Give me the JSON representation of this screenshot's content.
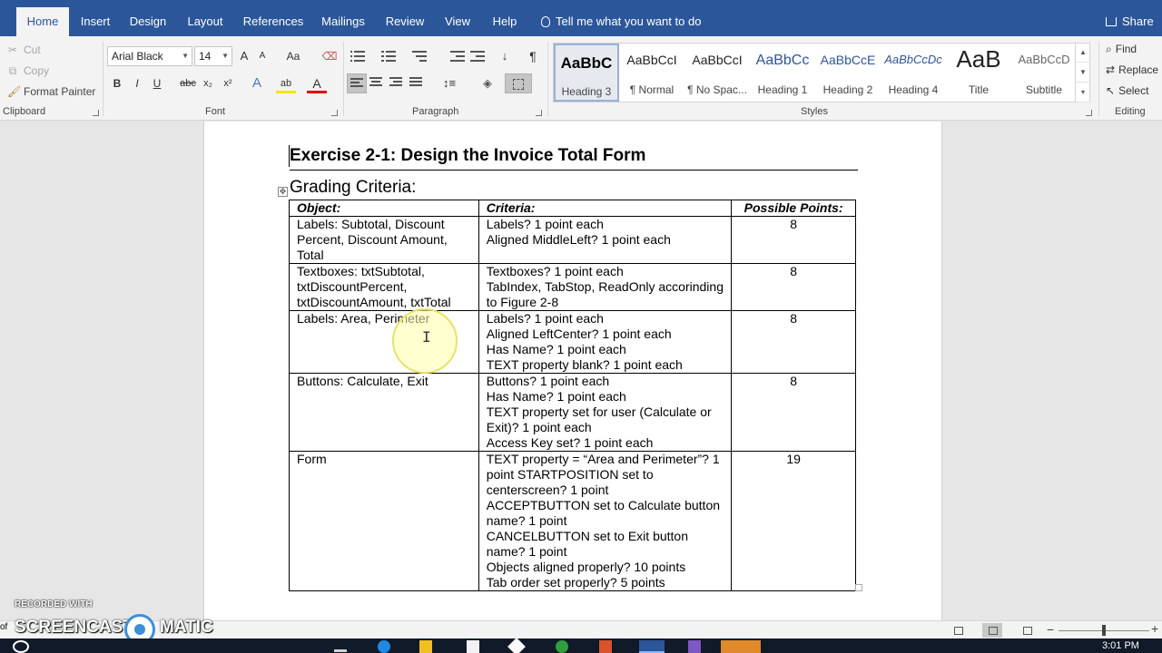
{
  "tabs": [
    {
      "label": "Home",
      "active": true
    },
    {
      "label": "Insert"
    },
    {
      "label": "Design"
    },
    {
      "label": "Layout"
    },
    {
      "label": "References"
    },
    {
      "label": "Mailings"
    },
    {
      "label": "Review"
    },
    {
      "label": "View"
    },
    {
      "label": "Help"
    }
  ],
  "tell_me": "Tell me what you want to do",
  "share": "Share",
  "clipboard": {
    "cut": "Cut",
    "copy": "Copy",
    "format_painter": "Format Painter",
    "label": "Clipboard"
  },
  "font": {
    "name": "Arial Black",
    "size": "14",
    "label": "Font",
    "grow": "A",
    "shrink": "A",
    "case": "Aa",
    "bold": "B",
    "italic": "I",
    "underline": "U",
    "strike": "abc",
    "subscript": "x₂",
    "superscript": "x²",
    "effects": "A",
    "highlight": "ab",
    "color": "A"
  },
  "paragraph": {
    "label": "Paragraph",
    "pilcrow": "¶"
  },
  "styles": {
    "label": "Styles",
    "items": [
      {
        "sample": "AaBbC",
        "name": "Heading 3",
        "selected": true
      },
      {
        "sample": "AaBbCcI",
        "name": "¶ Normal"
      },
      {
        "sample": "AaBbCcI",
        "name": "¶ No Spac..."
      },
      {
        "sample": "AaBbCc",
        "name": "Heading 1"
      },
      {
        "sample": "AaBbCcE",
        "name": "Heading 2"
      },
      {
        "sample": "AaBbCcDc",
        "name": "Heading 4"
      },
      {
        "sample": "AaB",
        "name": "Title"
      },
      {
        "sample": "AaBbCcD",
        "name": "Subtitle"
      }
    ]
  },
  "editing": {
    "label": "Editing",
    "find": "Find",
    "replace": "Replace",
    "select": "Select"
  },
  "document": {
    "title": "Exercise 2-1:  Design the Invoice Total Form",
    "subtitle": "Grading Criteria:",
    "table": {
      "headers": [
        "Object:",
        "Criteria:",
        "Possible Points:"
      ],
      "rows": [
        {
          "object": "Labels: Subtotal, Discount Percent, Discount Amount, Total",
          "criteria": [
            "Labels? 1 point each",
            "Aligned MiddleLeft? 1 point each"
          ],
          "points": "8"
        },
        {
          "object": "Textboxes: txtSubtotal, txtDiscountPercent, txtDiscountAmount, txtTotal",
          "criteria": [
            "Textboxes? 1 point each",
            "TabIndex, TabStop, ReadOnly accorinding to Figure 2-8"
          ],
          "points": "8"
        },
        {
          "object": "Labels: Area, Perimeter",
          "criteria": [
            "Labels? 1 point each",
            "Aligned LeftCenter? 1 point each",
            "Has Name? 1 point each",
            "TEXT property blank? 1 point each"
          ],
          "points": "8"
        },
        {
          "object": "Buttons: Calculate, Exit",
          "criteria": [
            "Buttons? 1 point each",
            "Has Name? 1 point each",
            "TEXT property set for user (Calculate or Exit)? 1 point each",
            "Access Key set? 1 point each"
          ],
          "points": "8"
        },
        {
          "object": "Form",
          "criteria": [
            "TEXT property = “Area and Perimeter”? 1 point STARTPOSITION set to centerscreen? 1 point",
            "ACCEPTBUTTON set to Calculate button name? 1 point",
            "CANCELBUTTON set to Exit button name? 1 point",
            "Objects aligned properly? 10 points",
            "Tab order set properly? 5 points"
          ],
          "points": "19"
        }
      ]
    }
  },
  "watermark": {
    "recorded_with": "RECORDED WITH",
    "brand_left": "SCREENCAST",
    "brand_right": "MATIC",
    "of": "of"
  },
  "clock": "3:01 PM",
  "colors": {
    "accent": "#2b579a",
    "ribbon": "#f3f3f3",
    "canvas": "#e6e6e6"
  }
}
